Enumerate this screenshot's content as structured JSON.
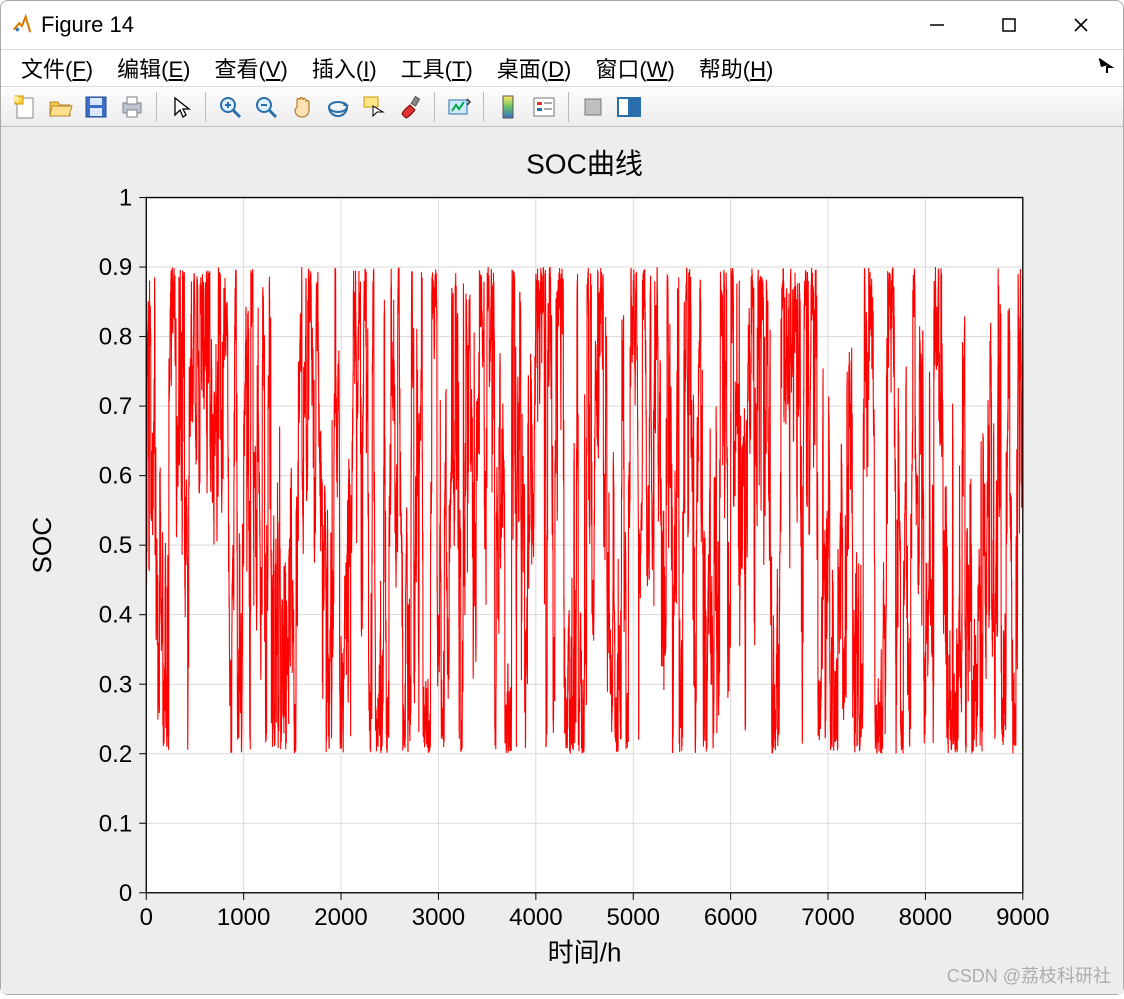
{
  "window": {
    "title": "Figure 14"
  },
  "menu": {
    "file": {
      "label": "文件",
      "accel": "F"
    },
    "edit": {
      "label": "编辑",
      "accel": "E"
    },
    "view": {
      "label": "查看",
      "accel": "V"
    },
    "insert": {
      "label": "插入",
      "accel": "I"
    },
    "tools": {
      "label": "工具",
      "accel": "T"
    },
    "desktop": {
      "label": "桌面",
      "accel": "D"
    },
    "window_": {
      "label": "窗口",
      "accel": "W"
    },
    "help": {
      "label": "帮助",
      "accel": "H"
    }
  },
  "toolbar": {
    "new_figure": "new-figure-icon",
    "open": "open-folder-icon",
    "save": "save-icon",
    "print": "print-icon",
    "pointer": "pointer-icon",
    "zoom_in": "zoom-in-icon",
    "zoom_out": "zoom-out-icon",
    "pan": "pan-hand-icon",
    "rotate3d": "rotate3d-icon",
    "data_cursor": "data-cursor-icon",
    "brush": "brush-icon",
    "link": "link-plots-icon",
    "colorbar": "colorbar-icon",
    "legend": "legend-icon",
    "hide_tools": "hide-tools-icon",
    "dock": "dock-figure-icon"
  },
  "chart_data": {
    "type": "line",
    "title": "SOC曲线",
    "xlabel": "时间/h",
    "ylabel": "SOC",
    "xlim": [
      0,
      9000
    ],
    "ylim": [
      0,
      1
    ],
    "xticks": [
      0,
      1000,
      2000,
      3000,
      4000,
      5000,
      6000,
      7000,
      8000,
      9000
    ],
    "yticks": [
      0,
      0.1,
      0.2,
      0.3,
      0.4,
      0.5,
      0.6,
      0.7,
      0.8,
      0.9,
      1
    ],
    "series": [
      {
        "name": "SOC",
        "color": "#ff0000",
        "description": "Dense noisy SOC time-series, ~8760 hourly points, values mostly between 0.2 and 0.9",
        "value_range_observed": [
          0.2,
          0.9
        ],
        "n_points_approx": 8760,
        "sample_values": [
          {
            "x": 0,
            "y": 0.8
          },
          {
            "x": 500,
            "y": 0.45
          },
          {
            "x": 1000,
            "y": 0.62
          },
          {
            "x": 1500,
            "y": 0.3
          },
          {
            "x": 2000,
            "y": 0.78
          },
          {
            "x": 2500,
            "y": 0.55
          },
          {
            "x": 3000,
            "y": 0.26
          },
          {
            "x": 3500,
            "y": 0.7
          },
          {
            "x": 4000,
            "y": 0.6
          },
          {
            "x": 4500,
            "y": 0.4
          },
          {
            "x": 5000,
            "y": 0.85
          },
          {
            "x": 5500,
            "y": 0.5
          },
          {
            "x": 6000,
            "y": 0.65
          },
          {
            "x": 6500,
            "y": 0.3
          },
          {
            "x": 7000,
            "y": 0.72
          },
          {
            "x": 7500,
            "y": 0.58
          },
          {
            "x": 8000,
            "y": 0.44
          },
          {
            "x": 8500,
            "y": 0.8
          },
          {
            "x": 8760,
            "y": 0.55
          }
        ]
      }
    ]
  },
  "watermark": "CSDN @荔枝科研社"
}
